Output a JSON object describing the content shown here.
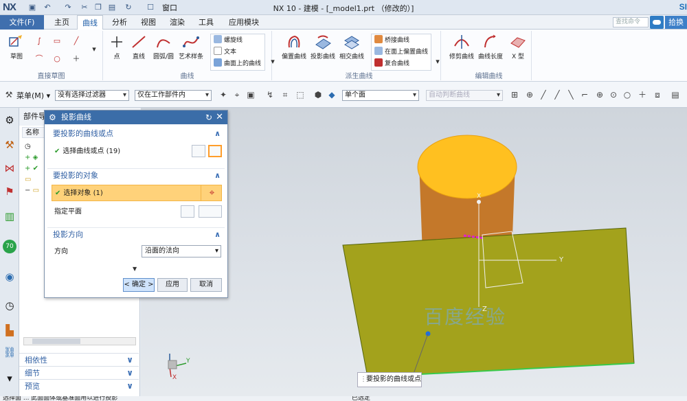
{
  "titlebar": {
    "logo": "NX",
    "window_menu": "窗口",
    "title": "NX 10 - 建模 - [_model1.prt （修改的）]",
    "brand": "SI"
  },
  "menubar": {
    "file": "文件(F)",
    "tabs": [
      "主页",
      "曲线",
      "分析",
      "视图",
      "渲染",
      "工具",
      "应用模块"
    ],
    "active_tab": "曲线",
    "search_placeholder": "查找命令",
    "expand_label": "拾换"
  },
  "ribbon": {
    "groups": {
      "direct_sketch": "直接草图",
      "curve": "曲线",
      "derived_curve": "派生曲线",
      "edit_curve": "编辑曲线"
    },
    "sketch": "草图",
    "point": "点",
    "line": "直线",
    "arc": "圆弧/圆",
    "studio_spline": "艺术样条",
    "helix": "螺旋线",
    "text": "文本",
    "curve_on_surface": "曲面上的曲线",
    "offset_curve": "偏置曲线",
    "project_curve": "投影曲线",
    "intersect_curve": "相交曲线",
    "bridge_curve": "桥接曲线",
    "offset_in_face": "在面上偏置曲线",
    "composite_curve": "复合曲线",
    "trim_curve": "修剪曲线",
    "curve_length": "曲线长度",
    "x_form": "X 型"
  },
  "selbar": {
    "menu": "菜单(M) ▾",
    "filter": "没有选择过滤器",
    "scope": "仅在工作部件内",
    "face_rule": "单个面",
    "snap": "自动判断曲线"
  },
  "navigator": {
    "title": "部件导航器",
    "column": "名称",
    "accordions": [
      "相依性",
      "细节",
      "预览"
    ]
  },
  "dialog": {
    "title": "投影曲线",
    "sec1": "要投影的曲线或点",
    "sel_curve": "选择曲线或点 (19)",
    "sec2": "要投影的对象",
    "sel_object": "选择对象 (1)",
    "plane": "指定平面",
    "sec3": "投影方向",
    "direction_label": "方向",
    "direction_value": "沿面的法向",
    "ok": "< 确定 >",
    "apply": "应用",
    "cancel": "取消"
  },
  "viewport": {
    "tooltip": "要投影的曲线或点",
    "watermark": "百度经验",
    "axis_y": "Y",
    "axis_z": "Z",
    "axis_x": "X",
    "triad_y": "Y",
    "triad_x": "X",
    "colors": {
      "cylinder_top": "#ffc020",
      "cylinder_side": "#c4782a",
      "plate": "#a3a21c",
      "plate_edge": "#38c94a"
    }
  },
  "status": {
    "left": "选择面 ... 此面面体或基准面用以进行投影",
    "right": "已选定"
  }
}
